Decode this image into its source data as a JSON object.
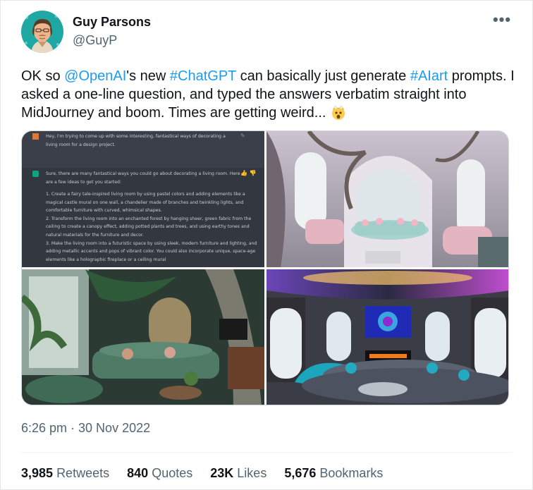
{
  "author": {
    "name": "Guy Parsons",
    "handle": "@GuyP"
  },
  "more_label": "•••",
  "tweet": {
    "p1": "OK so ",
    "mention": "@OpenAI",
    "p2": "'s new ",
    "hashtag1": "#ChatGPT",
    "p3": " can basically just generate ",
    "hashtag2": "#AIart",
    "p4": " prompts. I asked a one-line question, and typed the answers verbatim straight into MidJourney and boom. Times are getting weird...",
    "emoji": "exploding-head-emoji"
  },
  "chat_screenshot": {
    "question": "Hey, I'm trying to come up with some interesting, fantastical ways of decorating a living room for a design project.",
    "answer_intro": "Sure, there are many fantastical ways you could go about decorating a living room. Here are a few ideas to get you started:",
    "items": [
      "1.  Create a fairy tale-inspired living room by using pastel colors and adding elements like a magical castle mural on one wall, a chandelier made of branches and twinkling lights, and comfortable furniture with curved, whimsical shapes.",
      "2.  Transform the living room into an enchanted forest by hanging sheer, green fabric from the ceiling to create a canopy effect, adding potted plants and trees, and using earthy tones and natural materials for the furniture and decor.",
      "3.  Make the living room into a futuristic space by using sleek, modern furniture and lighting, and adding metallic accents and pops of vibrant color. You could also incorporate unique, space-age elements like a holographic fireplace or a ceiling mural"
    ]
  },
  "media": {
    "images": [
      "fairy-tale-living-room-image",
      "enchanted-forest-living-room-image",
      "futuristic-living-room-image"
    ]
  },
  "timestamp": "6:26 pm · 30 Nov 2022",
  "stats": [
    {
      "num": "3,985",
      "label": "Retweets"
    },
    {
      "num": "840",
      "label": "Quotes"
    },
    {
      "num": "23K",
      "label": "Likes"
    },
    {
      "num": "5,676",
      "label": "Bookmarks"
    }
  ],
  "colors": {
    "link": "#1d9bf0",
    "text": "#0f1419",
    "secondary": "#536471"
  }
}
